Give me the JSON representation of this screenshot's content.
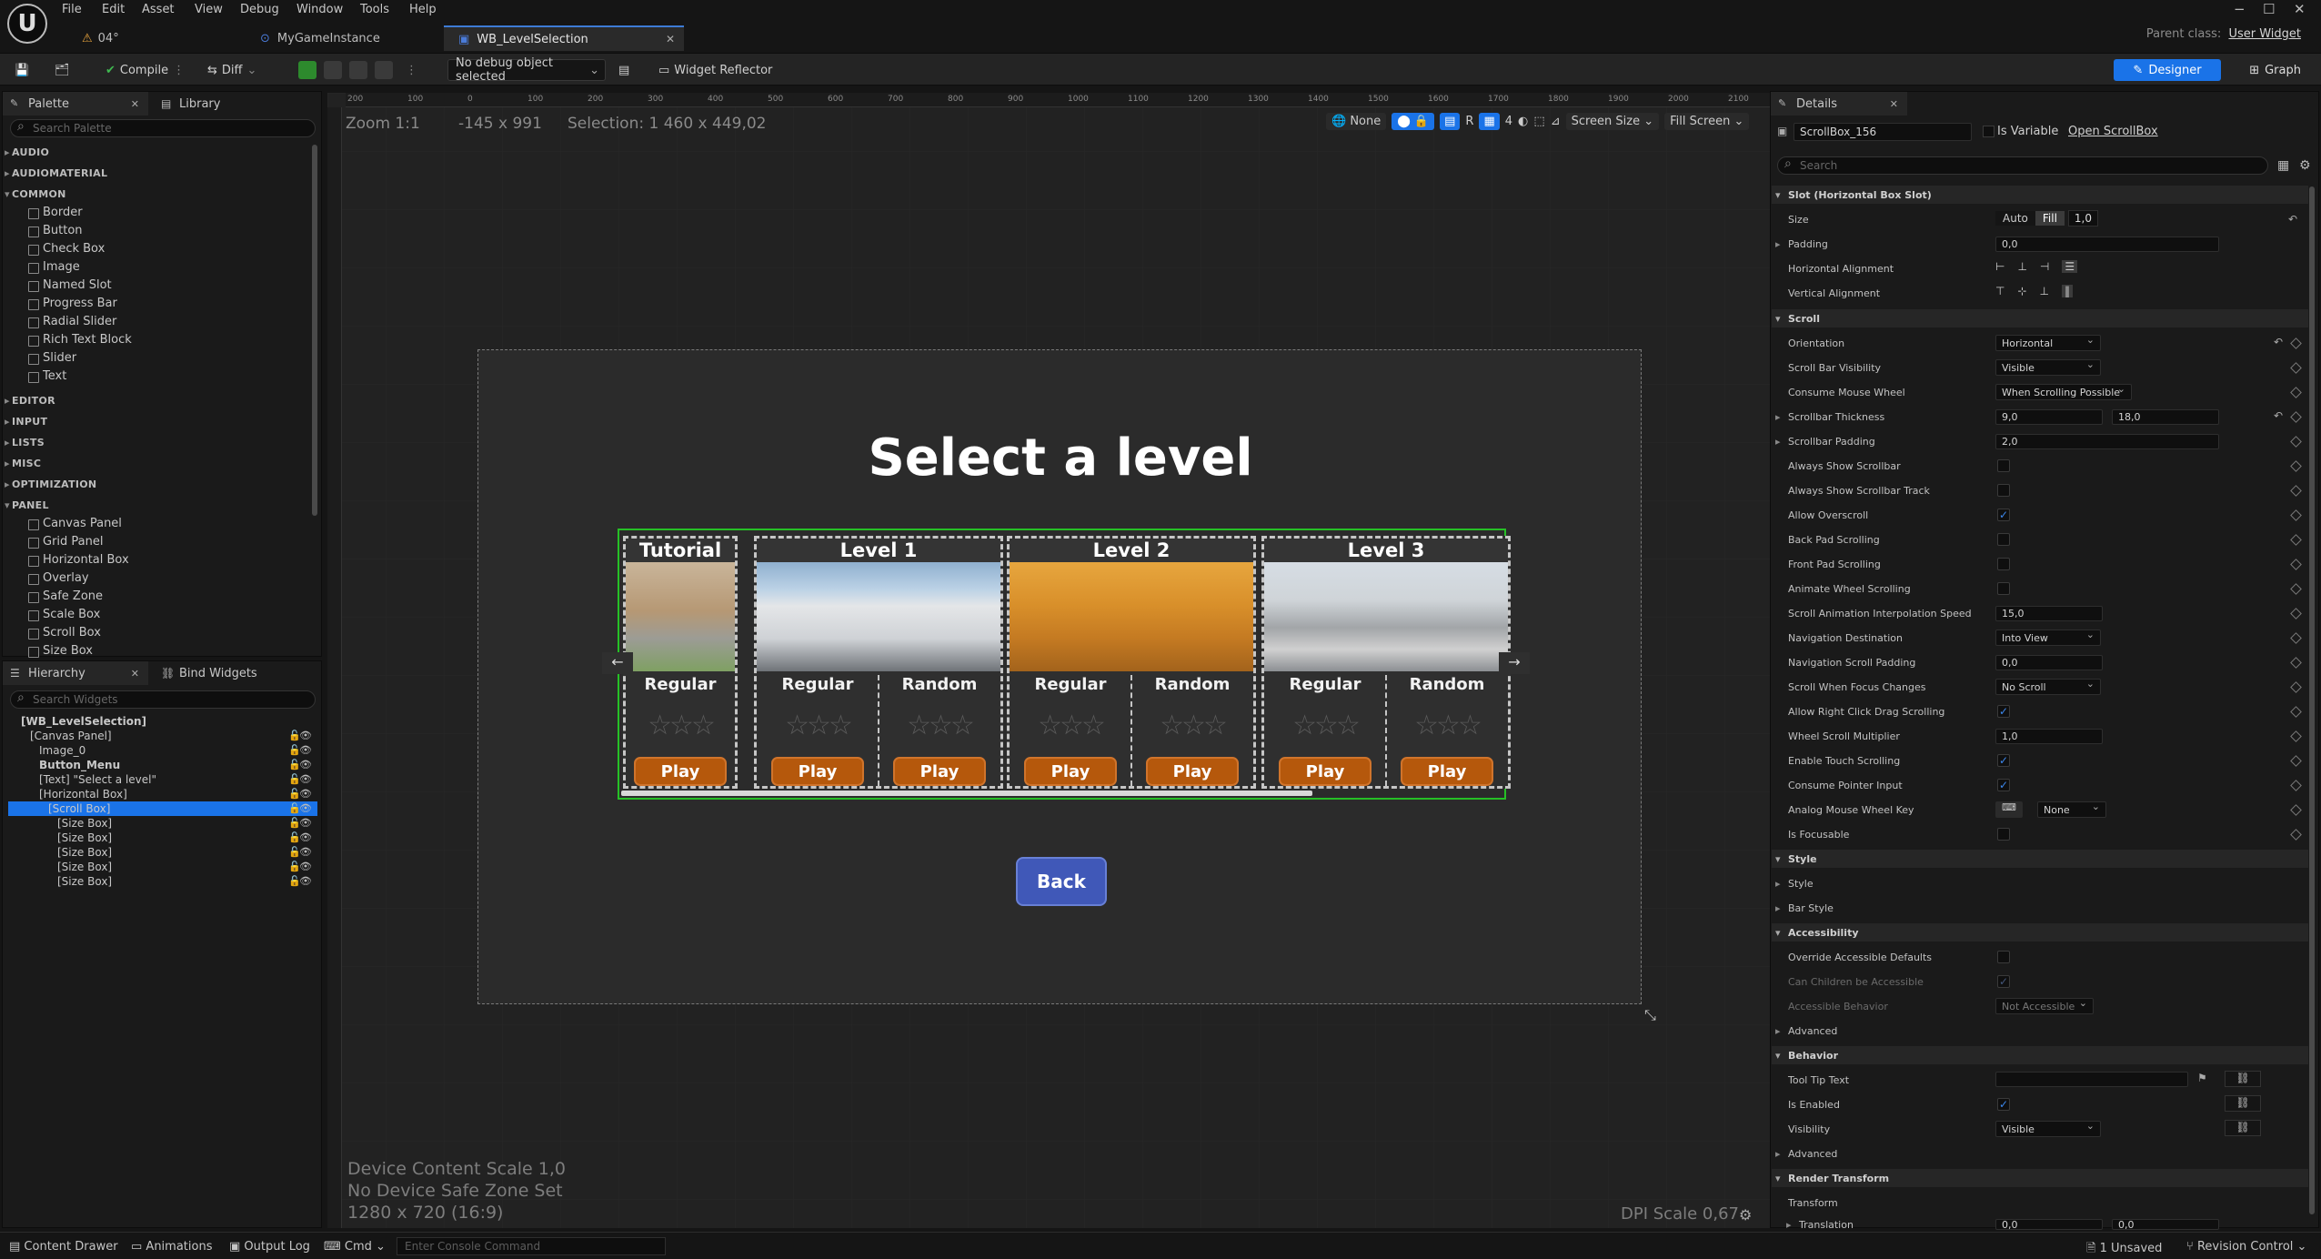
{
  "menu": [
    "File",
    "Edit",
    "Asset",
    "View",
    "Debug",
    "Window",
    "Tools",
    "Help"
  ],
  "project": "04",
  "window_controls": [
    "−",
    "☐",
    "✕"
  ],
  "tabs": [
    {
      "label": "MyGameInstance"
    },
    {
      "label": "WB_LevelSelection"
    }
  ],
  "parent_class": {
    "label": "Parent class:",
    "value": "User Widget"
  },
  "toolbar": {
    "compile": "Compile",
    "diff": "Diff",
    "debug_object": "No debug object selected",
    "widget_reflector": "Widget Reflector",
    "designer": "Designer",
    "graph": "Graph"
  },
  "palette": {
    "tab": "Palette",
    "library_tab": "Library",
    "search_placeholder": "Search Palette",
    "categories_top": [
      "AUDIO",
      "AUDIOMATERIAL",
      "COMMON"
    ],
    "common_items": [
      "Border",
      "Button",
      "Check Box",
      "Image",
      "Named Slot",
      "Progress Bar",
      "Radial Slider",
      "Rich Text Block",
      "Slider",
      "Text"
    ],
    "categories_mid": [
      "EDITOR",
      "INPUT",
      "LISTS",
      "MISC",
      "OPTIMIZATION",
      "PANEL"
    ],
    "panel_items": [
      "Canvas Panel",
      "Grid Panel",
      "Horizontal Box",
      "Overlay",
      "Safe Zone",
      "Scale Box",
      "Scroll Box",
      "Size Box"
    ]
  },
  "hierarchy": {
    "tab": "Hierarchy",
    "bind_tab": "Bind Widgets",
    "search_placeholder": "Search Widgets",
    "items": [
      {
        "label": "[WB_LevelSelection]",
        "indent": 0
      },
      {
        "label": "[Canvas Panel]",
        "indent": 1
      },
      {
        "label": "Image_0",
        "indent": 2
      },
      {
        "label": "Button_Menu",
        "indent": 2
      },
      {
        "label": "[Text] \"Select a level\"",
        "indent": 2
      },
      {
        "label": "[Horizontal Box]",
        "indent": 2
      },
      {
        "label": "[Scroll Box]",
        "indent": 3
      },
      {
        "label": "[Size Box]",
        "indent": 4
      },
      {
        "label": "[Size Box]",
        "indent": 4
      },
      {
        "label": "[Size Box]",
        "indent": 4
      },
      {
        "label": "[Size Box]",
        "indent": 4
      },
      {
        "label": "[Size Box]",
        "indent": 4
      }
    ],
    "selected_index": 6
  },
  "viewport": {
    "zoom": "Zoom 1:1",
    "coords": "-145 x 991",
    "selection": "Selection: 1 460 x 449,02",
    "ruler_labels": [
      "200",
      "100",
      "0",
      "100",
      "200",
      "300",
      "400",
      "500",
      "600",
      "700",
      "800",
      "900",
      "1000",
      "1100",
      "1200",
      "1300",
      "1400",
      "1500",
      "1600",
      "1700",
      "1800",
      "1900",
      "2000",
      "2100"
    ],
    "top_controls": {
      "none": "None",
      "r": "R",
      "grid": "4",
      "screen_size": "Screen Size",
      "fill_screen": "Fill Screen"
    },
    "device_scale": "Device Content Scale 1,0",
    "safe_zone": "No Device Safe Zone Set",
    "resolution": "1280 x 720 (16:9)",
    "dpi": "DPI Scale 0,67"
  },
  "widget": {
    "title": "Select a level",
    "back": "Back",
    "levels": [
      {
        "name": "Tutorial",
        "modes": [
          "Regular"
        ]
      },
      {
        "name": "Level 1",
        "modes": [
          "Regular",
          "Random"
        ]
      },
      {
        "name": "Level 2",
        "modes": [
          "Regular",
          "Random"
        ]
      },
      {
        "name": "Level 3",
        "modes": [
          "Regular",
          "Random"
        ]
      }
    ],
    "play": "Play",
    "stars": "☆☆☆",
    "left_arrow": "←",
    "right_arrow": "→"
  },
  "details": {
    "tab": "Details",
    "name": "ScrollBox_156",
    "is_variable": "Is Variable",
    "open_link": "Open ScrollBox",
    "search_placeholder": "Search",
    "slot_section": "Slot (Horizontal Box Slot)",
    "size_label": "Size",
    "size_auto": "Auto",
    "size_fill": "Fill",
    "size_value": "1,0",
    "padding_label": "Padding",
    "padding_value": "0,0",
    "halign_label": "Horizontal Alignment",
    "valign_label": "Vertical Alignment",
    "scroll_section": "Scroll",
    "props": [
      {
        "label": "Orientation",
        "kind": "dd",
        "value": "Horizontal"
      },
      {
        "label": "Scroll Bar Visibility",
        "kind": "dd",
        "value": "Visible"
      },
      {
        "label": "Consume Mouse Wheel",
        "kind": "dd",
        "value": "When Scrolling Possible"
      },
      {
        "label": "Scrollbar Thickness",
        "kind": "pair",
        "value": "9,0",
        "value2": "18,0"
      },
      {
        "label": "Scrollbar Padding",
        "kind": "field",
        "value": "2,0"
      },
      {
        "label": "Always Show Scrollbar",
        "kind": "cb",
        "value": ""
      },
      {
        "label": "Always Show Scrollbar Track",
        "kind": "cb",
        "value": ""
      },
      {
        "label": "Allow Overscroll",
        "kind": "cb",
        "value": "✓"
      },
      {
        "label": "Back Pad Scrolling",
        "kind": "cb",
        "value": ""
      },
      {
        "label": "Front Pad Scrolling",
        "kind": "cb",
        "value": ""
      },
      {
        "label": "Animate Wheel Scrolling",
        "kind": "cb",
        "value": ""
      },
      {
        "label": "Scroll Animation Interpolation Speed",
        "kind": "field",
        "value": "15,0"
      },
      {
        "label": "Navigation Destination",
        "kind": "dd",
        "value": "Into View"
      },
      {
        "label": "Navigation Scroll Padding",
        "kind": "field",
        "value": "0,0"
      },
      {
        "label": "Scroll When Focus Changes",
        "kind": "dd",
        "value": "No Scroll"
      },
      {
        "label": "Allow Right Click Drag Scrolling",
        "kind": "cb",
        "value": "✓"
      },
      {
        "label": "Wheel Scroll Multiplier",
        "kind": "field",
        "value": "1,0"
      },
      {
        "label": "Enable Touch Scrolling",
        "kind": "cb",
        "value": "✓"
      },
      {
        "label": "Consume Pointer Input",
        "kind": "cb",
        "value": "✓"
      },
      {
        "label": "Analog Mouse Wheel Key",
        "kind": "key",
        "value": "None"
      },
      {
        "label": "Is Focusable",
        "kind": "cb",
        "value": ""
      }
    ],
    "style_section": "Style",
    "style_items": [
      "Style",
      "Bar Style"
    ],
    "accessibility_section": "Accessibility",
    "override_access": "Override Accessible Defaults",
    "children_access": "Can Children be Accessible",
    "access_behavior": "Accessible Behavior",
    "access_behavior_value": "Not Accessible",
    "advanced": "Advanced",
    "behavior_section": "Behavior",
    "tooltip": "Tool Tip Text",
    "is_enabled": "Is Enabled",
    "visibility": "Visibility",
    "visibility_value": "Visible",
    "render_section": "Render Transform",
    "transform": "Transform",
    "translation": "Translation",
    "translation_values": [
      "0,0",
      "0,0"
    ]
  },
  "status": {
    "content_drawer": "Content Drawer",
    "animations": "Animations",
    "output_log": "Output Log",
    "cmd": "Cmd",
    "console_placeholder": "Enter Console Command",
    "unsaved": "1 Unsaved",
    "revision": "Revision Control"
  }
}
